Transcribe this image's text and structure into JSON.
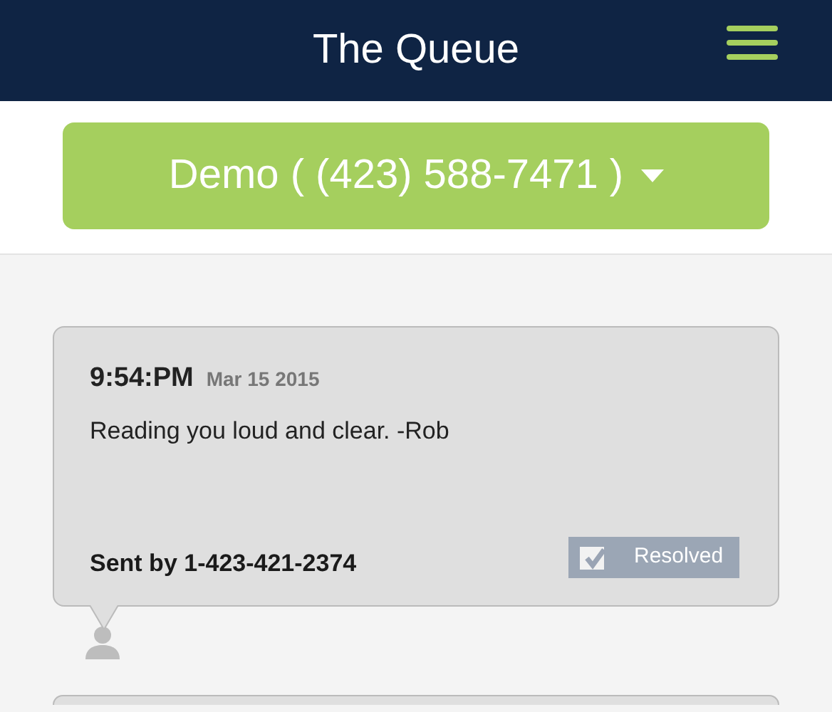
{
  "header": {
    "title": "The Queue"
  },
  "account_selector": {
    "label": "Demo ( (423) 588-7471 )"
  },
  "messages": [
    {
      "time": "9:54:PM",
      "date": "Mar 15 2015",
      "text": "Reading you loud and clear. -Rob",
      "sender": "Sent by 1-423-421-2374",
      "resolve_label": "Resolved",
      "checked": true
    }
  ]
}
